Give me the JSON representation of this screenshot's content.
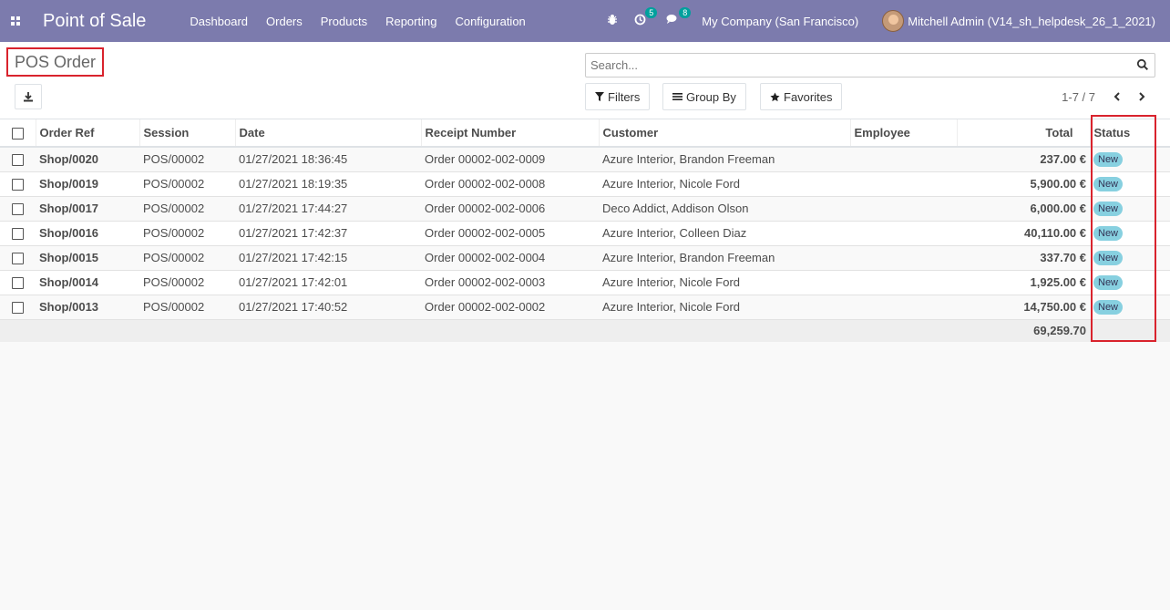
{
  "navbar": {
    "brand": "Point of Sale",
    "menu": [
      "Dashboard",
      "Orders",
      "Products",
      "Reporting",
      "Configuration"
    ],
    "activity_count": "5",
    "message_count": "8",
    "company": "My Company (San Francisco)",
    "user": "Mitchell Admin (V14_sh_helpdesk_26_1_2021)"
  },
  "control": {
    "title": "POS Order",
    "search_placeholder": "Search...",
    "filters_label": "Filters",
    "groupby_label": "Group By",
    "favorites_label": "Favorites",
    "pager": "1-7 / 7"
  },
  "table": {
    "columns": [
      "Order Ref",
      "Session",
      "Date",
      "Receipt Number",
      "Customer",
      "Employee",
      "Total",
      "Status"
    ],
    "rows": [
      {
        "ref": "Shop/0020",
        "session": "POS/00002",
        "date": "01/27/2021 18:36:45",
        "receipt": "Order 00002-002-0009",
        "customer": "Azure Interior, Brandon Freeman",
        "employee": "",
        "total": "237.00 €",
        "status": "New"
      },
      {
        "ref": "Shop/0019",
        "session": "POS/00002",
        "date": "01/27/2021 18:19:35",
        "receipt": "Order 00002-002-0008",
        "customer": "Azure Interior, Nicole Ford",
        "employee": "",
        "total": "5,900.00 €",
        "status": "New"
      },
      {
        "ref": "Shop/0017",
        "session": "POS/00002",
        "date": "01/27/2021 17:44:27",
        "receipt": "Order 00002-002-0006",
        "customer": "Deco Addict, Addison Olson",
        "employee": "",
        "total": "6,000.00 €",
        "status": "New"
      },
      {
        "ref": "Shop/0016",
        "session": "POS/00002",
        "date": "01/27/2021 17:42:37",
        "receipt": "Order 00002-002-0005",
        "customer": "Azure Interior, Colleen Diaz",
        "employee": "",
        "total": "40,110.00 €",
        "status": "New"
      },
      {
        "ref": "Shop/0015",
        "session": "POS/00002",
        "date": "01/27/2021 17:42:15",
        "receipt": "Order 00002-002-0004",
        "customer": "Azure Interior, Brandon Freeman",
        "employee": "",
        "total": "337.70 €",
        "status": "New"
      },
      {
        "ref": "Shop/0014",
        "session": "POS/00002",
        "date": "01/27/2021 17:42:01",
        "receipt": "Order 00002-002-0003",
        "customer": "Azure Interior, Nicole Ford",
        "employee": "",
        "total": "1,925.00 €",
        "status": "New"
      },
      {
        "ref": "Shop/0013",
        "session": "POS/00002",
        "date": "01/27/2021 17:40:52",
        "receipt": "Order 00002-002-0002",
        "customer": "Azure Interior, Nicole Ford",
        "employee": "",
        "total": "14,750.00 €",
        "status": "New"
      }
    ],
    "footer_total": "69,259.70"
  }
}
